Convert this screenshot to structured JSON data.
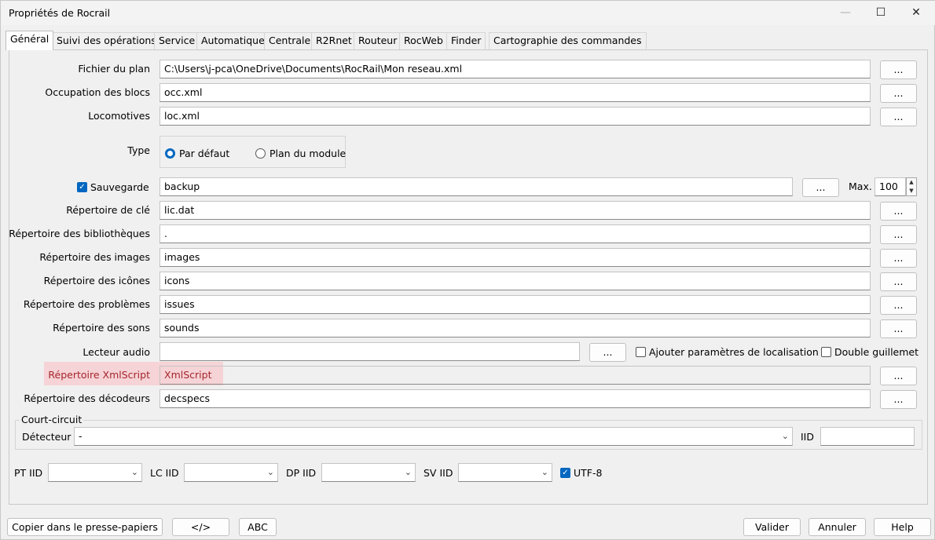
{
  "window": {
    "title": "Propriétés de Rocrail",
    "minimize": "—",
    "maximize": "☐",
    "close": "✕"
  },
  "tabs": [
    "Général",
    "Suivi des opérations",
    "Service",
    "Automatique",
    "Centrale",
    "R2Rnet",
    "Routeur",
    "RocWeb",
    "Finder",
    "Cartographie des commandes"
  ],
  "browse_label": "...",
  "fields": {
    "plan": {
      "label": "Fichier du plan",
      "value": "C:\\Users\\j-pca\\OneDrive\\Documents\\RocRail\\Mon reseau.xml"
    },
    "blocks": {
      "label": "Occupation des blocs",
      "value": "occ.xml"
    },
    "locos": {
      "label": "Locomotives",
      "value": "loc.xml"
    },
    "backup": {
      "label": "Sauvegarde",
      "value": "backup",
      "checked": true,
      "max_label": "Max.",
      "max_value": "100"
    },
    "key": {
      "label": "Répertoire de clé",
      "value": "lic.dat"
    },
    "libs": {
      "label": "Répertoire des bibliothèques",
      "value": "."
    },
    "images": {
      "label": "Répertoire des images",
      "value": "images"
    },
    "icons": {
      "label": "Répertoire des icônes",
      "value": "icons"
    },
    "issues": {
      "label": "Répertoire des problèmes",
      "value": "issues"
    },
    "sounds": {
      "label": "Répertoire des sons",
      "value": "sounds"
    },
    "audio": {
      "label": "Lecteur audio",
      "value": ""
    },
    "xmlscript": {
      "label": "Répertoire  XmlScript",
      "value": "XmlScript"
    },
    "decoders": {
      "label": "Répertoire des décodeurs",
      "value": "decspecs"
    }
  },
  "type": {
    "label": "Type",
    "options": [
      "Par défaut",
      "Plan du module"
    ],
    "selected": "Par défaut"
  },
  "audio_options": {
    "localization": "Ajouter paramètres de localisation",
    "double_quote": "Double guillemet"
  },
  "short_circuit": {
    "title": "Court-circuit",
    "detector_label": "Détecteur",
    "detector_value": "-",
    "iid_label": "IID",
    "iid_value": ""
  },
  "iids": {
    "pt": "PT IID",
    "lc": "LC IID",
    "dp": "DP IID",
    "sv": "SV IID",
    "utf8": "UTF-8",
    "utf8_checked": true
  },
  "bottom": {
    "copy": "Copier dans le presse-papiers",
    "code": "</>",
    "abc": "ABC",
    "ok": "Valider",
    "cancel": "Annuler",
    "help": "Help"
  },
  "colors": {
    "accent": "#0067c0",
    "highlight": "#f6d3d6",
    "highlight_text": "#a4262c"
  }
}
